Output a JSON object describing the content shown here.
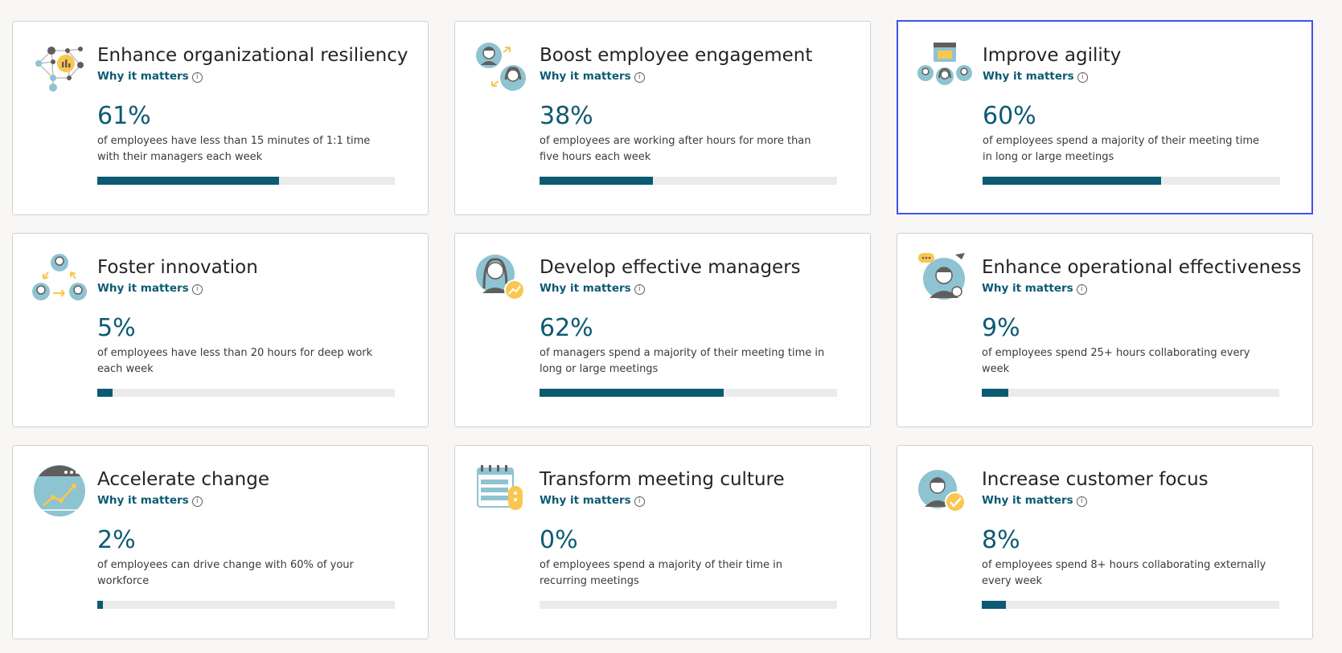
{
  "why_label": "Why it matters",
  "info_glyph": "i",
  "colors": {
    "accent": "#0c5a73",
    "track": "#ebebeb",
    "selected_border": "#4053e8",
    "icon_teal": "#8ec3d1",
    "icon_yellow": "#f9c74f"
  },
  "cards": [
    {
      "title": "Enhance organizational resiliency",
      "percent": "61%",
      "fill": 0.61,
      "description": "of employees have less than 15 minutes of 1:1 time with their managers each week",
      "icon": "network-chart-icon"
    },
    {
      "title": "Boost employee engagement",
      "percent": "38%",
      "fill": 0.38,
      "description": "of employees are working after hours for more than five hours each week",
      "icon": "people-exchange-icon"
    },
    {
      "title": "Improve agility",
      "percent": "60%",
      "fill": 0.6,
      "description": "of employees spend a majority of their meeting time in long or large meetings",
      "icon": "calendar-people-icon",
      "selected": true
    },
    {
      "title": "Foster innovation",
      "percent": "5%",
      "fill": 0.05,
      "description": "of employees have less than 20 hours for deep work each week",
      "icon": "people-cycle-icon"
    },
    {
      "title": "Develop effective managers",
      "percent": "62%",
      "fill": 0.62,
      "description": "of managers spend a majority of their meeting time in long or large meetings",
      "icon": "manager-growth-icon"
    },
    {
      "title": "Enhance operational effectiveness",
      "percent": "9%",
      "fill": 0.09,
      "description": "of employees spend 25+ hours collaborating every week",
      "icon": "person-chat-icon"
    },
    {
      "title": "Accelerate change",
      "percent": "2%",
      "fill": 0.02,
      "description": "of employees can drive change with 60% of your workforce",
      "icon": "trend-window-icon"
    },
    {
      "title": "Transform meeting culture",
      "percent": "0%",
      "fill": 0.0,
      "description": "of employees spend a majority of their time in recurring meetings",
      "icon": "calendar-recurring-icon"
    },
    {
      "title": "Increase customer focus",
      "percent": "8%",
      "fill": 0.08,
      "description": "of employees spend 8+ hours collaborating externally every week",
      "icon": "person-check-icon"
    }
  ]
}
